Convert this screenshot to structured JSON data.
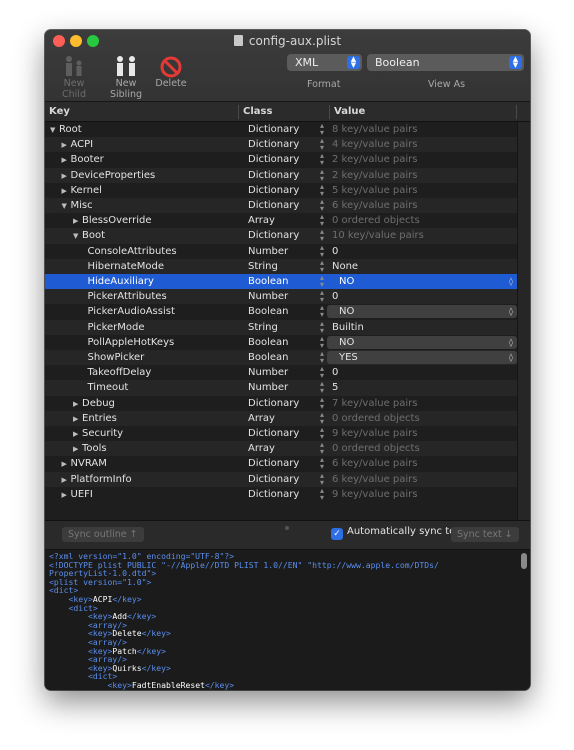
{
  "window": {
    "title": "config-aux.plist",
    "traffic_colors": {
      "close": "#ff5f57",
      "minimize": "#febc2e",
      "zoom": "#28c840"
    }
  },
  "toolbar": {
    "new_child": "New Child",
    "new_sibling": "New Sibling",
    "delete": "Delete",
    "format_value": "XML",
    "format_label": "Format",
    "view_as_value": "Boolean",
    "view_as_label": "View As"
  },
  "columns": {
    "key": "Key",
    "class": "Class",
    "value": "Value"
  },
  "rows": [
    {
      "key": "Root",
      "tri": "▼",
      "cls": "Dictionary",
      "value": "8 key/value pairs",
      "dim": true
    },
    {
      "key": "ACPI",
      "tri": "▶",
      "cls": "Dictionary",
      "value": "4 key/value pairs",
      "dim": true
    },
    {
      "key": "Booter",
      "tri": "▶",
      "cls": "Dictionary",
      "value": "2 key/value pairs",
      "dim": true
    },
    {
      "key": "DeviceProperties",
      "tri": "▶",
      "cls": "Dictionary",
      "value": "2 key/value pairs",
      "dim": true
    },
    {
      "key": "Kernel",
      "tri": "▶",
      "cls": "Dictionary",
      "value": "5 key/value pairs",
      "dim": true
    },
    {
      "key": "Misc",
      "tri": "▼",
      "cls": "Dictionary",
      "value": "6 key/value pairs",
      "dim": true
    },
    {
      "key": "BlessOverride",
      "tri": "▶",
      "cls": "Array",
      "value": "0 ordered objects",
      "dim": true
    },
    {
      "key": "Boot",
      "tri": "▼",
      "cls": "Dictionary",
      "value": "10 key/value pairs",
      "dim": true
    },
    {
      "key": "ConsoleAttributes",
      "tri": "",
      "cls": "Number",
      "value": "0"
    },
    {
      "key": "HibernateMode",
      "tri": "",
      "cls": "String",
      "value": "None"
    },
    {
      "key": "HideAuxiliary",
      "tri": "",
      "cls": "Boolean",
      "value": "NO",
      "popup": true,
      "selected": true
    },
    {
      "key": "PickerAttributes",
      "tri": "",
      "cls": "Number",
      "value": "0"
    },
    {
      "key": "PickerAudioAssist",
      "tri": "",
      "cls": "Boolean",
      "value": "NO",
      "popup": true
    },
    {
      "key": "PickerMode",
      "tri": "",
      "cls": "String",
      "value": "Builtin"
    },
    {
      "key": "PollAppleHotKeys",
      "tri": "",
      "cls": "Boolean",
      "value": "NO",
      "popup": true
    },
    {
      "key": "ShowPicker",
      "tri": "",
      "cls": "Boolean",
      "value": "YES",
      "popup": true
    },
    {
      "key": "TakeoffDelay",
      "tri": "",
      "cls": "Number",
      "value": "0"
    },
    {
      "key": "Timeout",
      "tri": "",
      "cls": "Number",
      "value": "5"
    },
    {
      "key": "Debug",
      "tri": "▶",
      "cls": "Dictionary",
      "value": "7 key/value pairs",
      "dim": true
    },
    {
      "key": "Entries",
      "tri": "▶",
      "cls": "Array",
      "value": "0 ordered objects",
      "dim": true
    },
    {
      "key": "Security",
      "tri": "▶",
      "cls": "Dictionary",
      "value": "9 key/value pairs",
      "dim": true
    },
    {
      "key": "Tools",
      "tri": "▶",
      "cls": "Array",
      "value": "0 ordered objects",
      "dim": true
    },
    {
      "key": "NVRAM",
      "tri": "▶",
      "cls": "Dictionary",
      "value": "6 key/value pairs",
      "dim": true
    },
    {
      "key": "PlatformInfo",
      "tri": "▶",
      "cls": "Dictionary",
      "value": "6 key/value pairs",
      "dim": true
    },
    {
      "key": "UEFI",
      "tri": "▶",
      "cls": "Dictionary",
      "value": "9 key/value pairs",
      "dim": true
    }
  ],
  "sync": {
    "outline_label": "Sync outline ↑",
    "auto_label": "Automatically sync text",
    "auto_checked": true,
    "text_label": "Sync text ↓"
  },
  "code_lines": [
    [
      [
        "t",
        "<?xml version=\"1.0\" encoding=\"UTF-8\"?>"
      ]
    ],
    [
      [
        "t",
        "<!DOCTYPE plist PUBLIC \"-//Apple//DTD PLIST 1.0//EN\" \"http://www.apple.com/DTDs/"
      ]
    ],
    [
      [
        "t",
        "PropertyList-1.0.dtd\">"
      ]
    ],
    [
      [
        "t",
        "<plist version=\"1.0\">"
      ]
    ],
    [
      [
        "t",
        "<dict>"
      ]
    ],
    [
      [
        "t",
        "    <key>"
      ],
      [
        "x",
        "ACPI"
      ],
      [
        "t",
        "</key>"
      ]
    ],
    [
      [
        "t",
        "    <dict>"
      ]
    ],
    [
      [
        "t",
        "        <key>"
      ],
      [
        "x",
        "Add"
      ],
      [
        "t",
        "</key>"
      ]
    ],
    [
      [
        "t",
        "        <array/>"
      ]
    ],
    [
      [
        "t",
        "        <key>"
      ],
      [
        "x",
        "Delete"
      ],
      [
        "t",
        "</key>"
      ]
    ],
    [
      [
        "t",
        "        <array/>"
      ]
    ],
    [
      [
        "t",
        "        <key>"
      ],
      [
        "x",
        "Patch"
      ],
      [
        "t",
        "</key>"
      ]
    ],
    [
      [
        "t",
        "        <array/>"
      ]
    ],
    [
      [
        "t",
        "        <key>"
      ],
      [
        "x",
        "Quirks"
      ],
      [
        "t",
        "</key>"
      ]
    ],
    [
      [
        "t",
        "        <dict>"
      ]
    ],
    [
      [
        "t",
        "            <key>"
      ],
      [
        "x",
        "FadtEnableReset"
      ],
      [
        "t",
        "</key>"
      ]
    ]
  ]
}
